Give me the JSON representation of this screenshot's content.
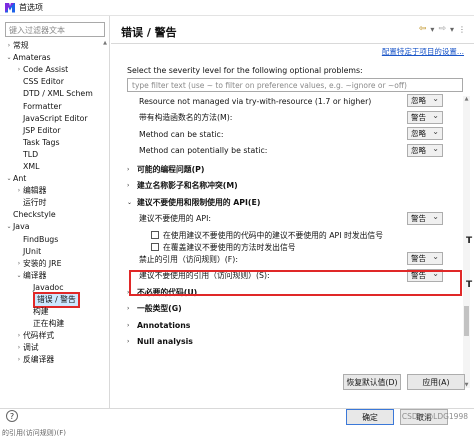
{
  "window": {
    "title": "首选项"
  },
  "left": {
    "filter_placeholder": "键入过滤器文本",
    "tree": [
      {
        "indent": 0,
        "toggle": "›",
        "label": "常规"
      },
      {
        "indent": 0,
        "toggle": "⌄",
        "label": "Amateras"
      },
      {
        "indent": 1,
        "toggle": "›",
        "label": "Code Assist"
      },
      {
        "indent": 1,
        "toggle": "",
        "label": "CSS Editor"
      },
      {
        "indent": 1,
        "toggle": "",
        "label": "DTD / XML Schem"
      },
      {
        "indent": 1,
        "toggle": "",
        "label": "Formatter"
      },
      {
        "indent": 1,
        "toggle": "",
        "label": "JavaScript Editor"
      },
      {
        "indent": 1,
        "toggle": "",
        "label": "JSP Editor"
      },
      {
        "indent": 1,
        "toggle": "",
        "label": "Task Tags"
      },
      {
        "indent": 1,
        "toggle": "",
        "label": "TLD"
      },
      {
        "indent": 1,
        "toggle": "",
        "label": "XML"
      },
      {
        "indent": 0,
        "toggle": "⌄",
        "label": "Ant"
      },
      {
        "indent": 1,
        "toggle": "›",
        "label": "编辑器"
      },
      {
        "indent": 1,
        "toggle": "",
        "label": "运行时"
      },
      {
        "indent": 0,
        "toggle": "",
        "label": "Checkstyle"
      },
      {
        "indent": 0,
        "toggle": "⌄",
        "label": "Java"
      },
      {
        "indent": 1,
        "toggle": "",
        "label": "FindBugs"
      },
      {
        "indent": 1,
        "toggle": "",
        "label": "JUnit"
      },
      {
        "indent": 1,
        "toggle": "›",
        "label": "安装的 JRE"
      },
      {
        "indent": 1,
        "toggle": "⌄",
        "label": "编译器"
      },
      {
        "indent": 2,
        "toggle": "",
        "label": "Javadoc"
      },
      {
        "indent": 2,
        "toggle": "",
        "label": "错误 / 警告",
        "selected": true
      },
      {
        "indent": 2,
        "toggle": "",
        "label": "构建"
      },
      {
        "indent": 2,
        "toggle": "",
        "label": "正在构建"
      },
      {
        "indent": 1,
        "toggle": "›",
        "label": "代码样式"
      },
      {
        "indent": 1,
        "toggle": "›",
        "label": "调试"
      },
      {
        "indent": 1,
        "toggle": "›",
        "label": "反编译器"
      }
    ]
  },
  "right": {
    "title": "错误 / 警告",
    "config_link": "配置特定于项目的设置...",
    "severity_label": "Select the severity level for the following optional problems:",
    "filter_placeholder": "type filter text (use ~ to filter on preference values, e.g. ~ignore or ~off)",
    "options": [
      {
        "kind": "combo",
        "indent": 1,
        "label": "Resource not managed via try-with-resource (1.7 or higher)",
        "value": "忽略"
      },
      {
        "kind": "combo",
        "indent": 1,
        "label": "带有构造函数名的方法(M):",
        "value": "警告"
      },
      {
        "kind": "combo",
        "indent": 1,
        "label": "Method can be static:",
        "value": "忽略"
      },
      {
        "kind": "combo",
        "indent": 1,
        "label": "Method can potentially be static:",
        "value": "忽略"
      },
      {
        "kind": "section",
        "indent": 0,
        "toggle": "›",
        "label": "可能的编程问题(P)"
      },
      {
        "kind": "section",
        "indent": 0,
        "toggle": "›",
        "label": "建立名称影子和名称冲突(M)"
      },
      {
        "kind": "section",
        "indent": 0,
        "toggle": "⌄",
        "label": "建议不要使用和限制使用的 API(E)"
      },
      {
        "kind": "combo",
        "indent": 1,
        "label": "建议不要使用的 API:",
        "value": "警告"
      },
      {
        "kind": "check",
        "indent": 2,
        "label": "在使用建议不要使用的代码中的建议不要使用的 API 时发出信号"
      },
      {
        "kind": "check",
        "indent": 2,
        "label": "在覆盖建议不要使用的方法时发出信号"
      },
      {
        "kind": "combo",
        "indent": 1,
        "label": "禁止的引用（访问规则）(F):",
        "value": "警告"
      },
      {
        "kind": "combo",
        "indent": 1,
        "label": "建议不要使用的引用（访问规则）(S):",
        "value": "警告"
      },
      {
        "kind": "section",
        "indent": 0,
        "toggle": "›",
        "label": "不必要的代码(U)"
      },
      {
        "kind": "section",
        "indent": 0,
        "toggle": "›",
        "label": "一般类型(G)"
      },
      {
        "kind": "section",
        "indent": 0,
        "toggle": "›",
        "label": "Annotations"
      },
      {
        "kind": "section",
        "indent": 0,
        "toggle": "›",
        "label": "Null analysis"
      }
    ],
    "restore_button": "恢复默认值(D)",
    "apply_button": "应用(A)"
  },
  "footer": {
    "ok_button": "确定",
    "cancel_button": "取消",
    "watermark": "CSDN @LDG1998",
    "cropped_text": "的引用(访问规则)(F)",
    "help_glyph": "?"
  },
  "outside": {
    "glyph": "T"
  },
  "colors": {
    "highlight_box": "#e02828",
    "selection": "#cde8ff",
    "link": "#1a55c8"
  }
}
